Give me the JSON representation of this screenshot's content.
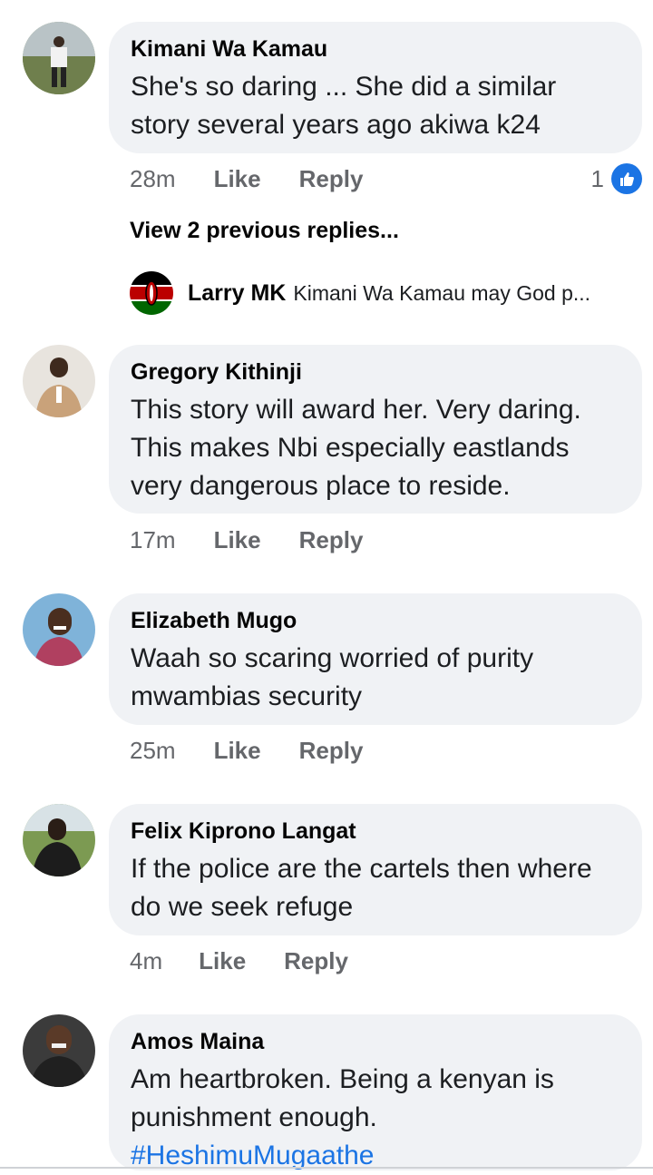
{
  "comments": [
    {
      "author": "Kimani Wa Kamau",
      "text": "She's so daring ... She did a similar story several years ago akiwa k24",
      "time": "28m",
      "like_label": "Like",
      "reply_label": "Reply",
      "reaction_count": "1"
    },
    {
      "author": "Gregory Kithinji",
      "text": "This story will award her. Very daring. This makes Nbi especially eastlands very dangerous place to reside.",
      "time": "17m",
      "like_label": "Like",
      "reply_label": "Reply"
    },
    {
      "author": "Elizabeth Mugo",
      "text": "Waah so scaring worried of purity mwambias security",
      "time": "25m",
      "like_label": "Like",
      "reply_label": "Reply"
    },
    {
      "author": "Felix Kiprono Langat",
      "text": "If the police are the cartels then where do we seek refuge",
      "time": "4m",
      "like_label": "Like",
      "reply_label": "Reply"
    },
    {
      "author": "Amos Maina",
      "text": "Am heartbroken. Being a kenyan is punishment enough.",
      "hashtag": "#HeshimuMugaathe"
    }
  ],
  "replies": {
    "view_previous_label": "View 2 previous replies...",
    "preview_author": "Larry MK",
    "preview_text": "Kimani Wa Kamau may God p..."
  },
  "colors": {
    "bubble": "#f0f2f5",
    "meta": "#65676b",
    "accent": "#1b74e4"
  },
  "icons": {
    "reaction": "like-thumbs-up-icon",
    "reply_avatar": "kenya-flag-icon"
  }
}
